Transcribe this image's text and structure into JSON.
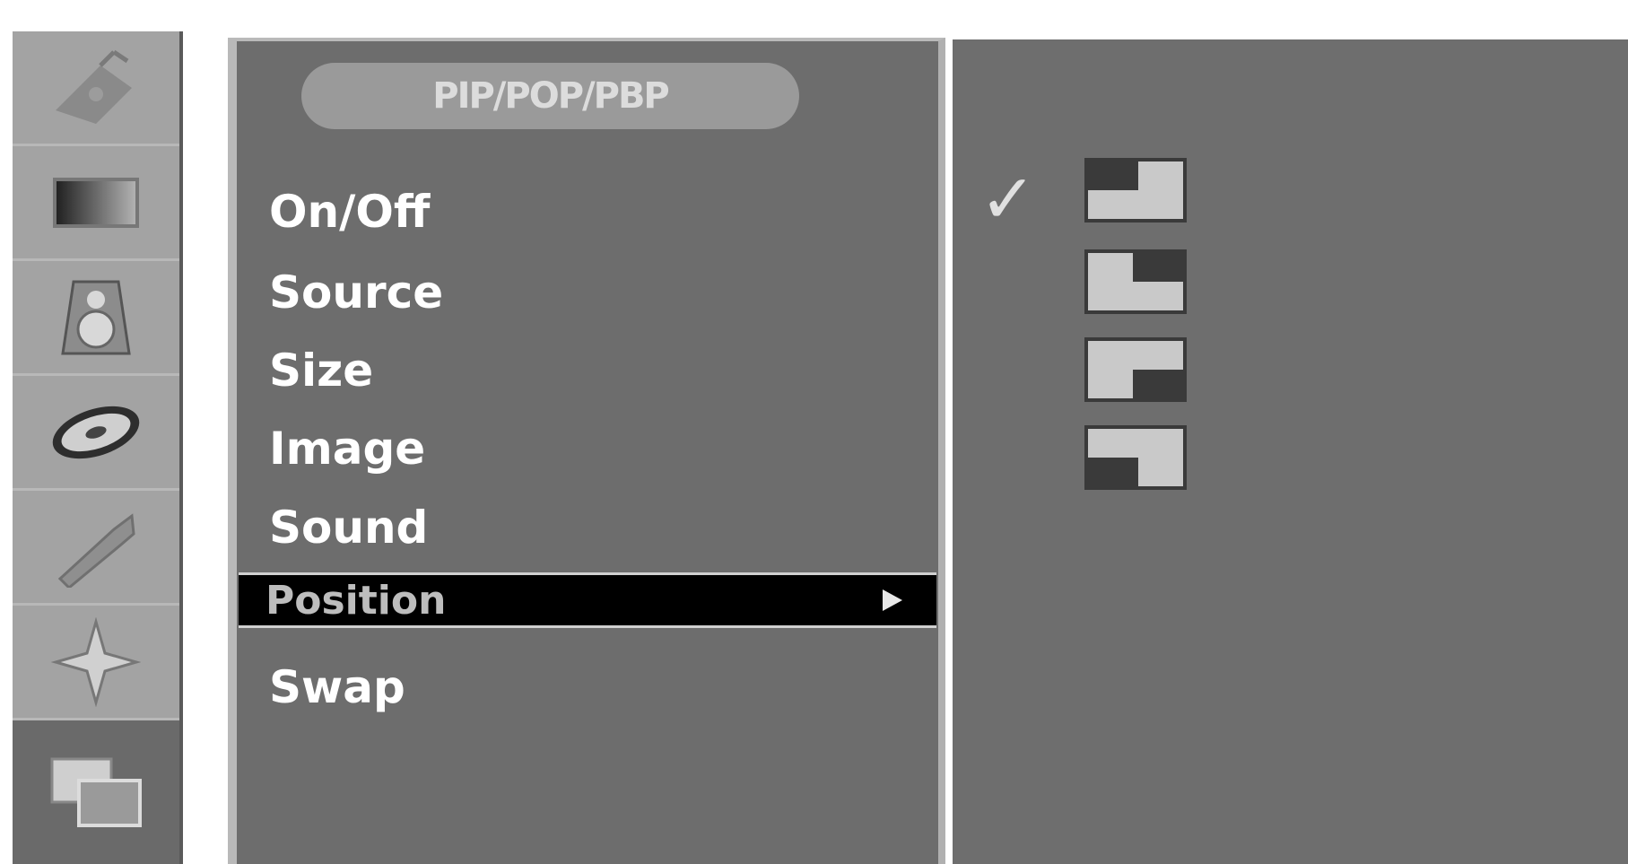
{
  "sidebar": {
    "items": [
      {
        "icon": "satellite-dish-icon"
      },
      {
        "icon": "picture-icon"
      },
      {
        "icon": "speaker-icon"
      },
      {
        "icon": "disc-time-icon"
      },
      {
        "icon": "wrench-option-icon"
      },
      {
        "icon": "screen-adjust-icon"
      },
      {
        "icon": "pip-icon",
        "selected": true
      }
    ]
  },
  "menu": {
    "title": "PIP/POP/PBP",
    "items": [
      {
        "label": "On/Off"
      },
      {
        "label": "Source"
      },
      {
        "label": "Size"
      },
      {
        "label": "Image"
      },
      {
        "label": "Sound"
      },
      {
        "label": "Position",
        "highlighted": true
      },
      {
        "label": "Swap"
      }
    ]
  },
  "options": {
    "checked_index": 0,
    "check_glyph": "✓",
    "positions": [
      {
        "icon": "position-top-left-icon"
      },
      {
        "icon": "position-top-right-icon"
      },
      {
        "icon": "position-bottom-right-icon"
      },
      {
        "icon": "position-bottom-left-icon"
      }
    ]
  },
  "colors": {
    "panel": "#6d6d6d",
    "highlight": "#000000",
    "sidebar": "#a3a3a3"
  }
}
